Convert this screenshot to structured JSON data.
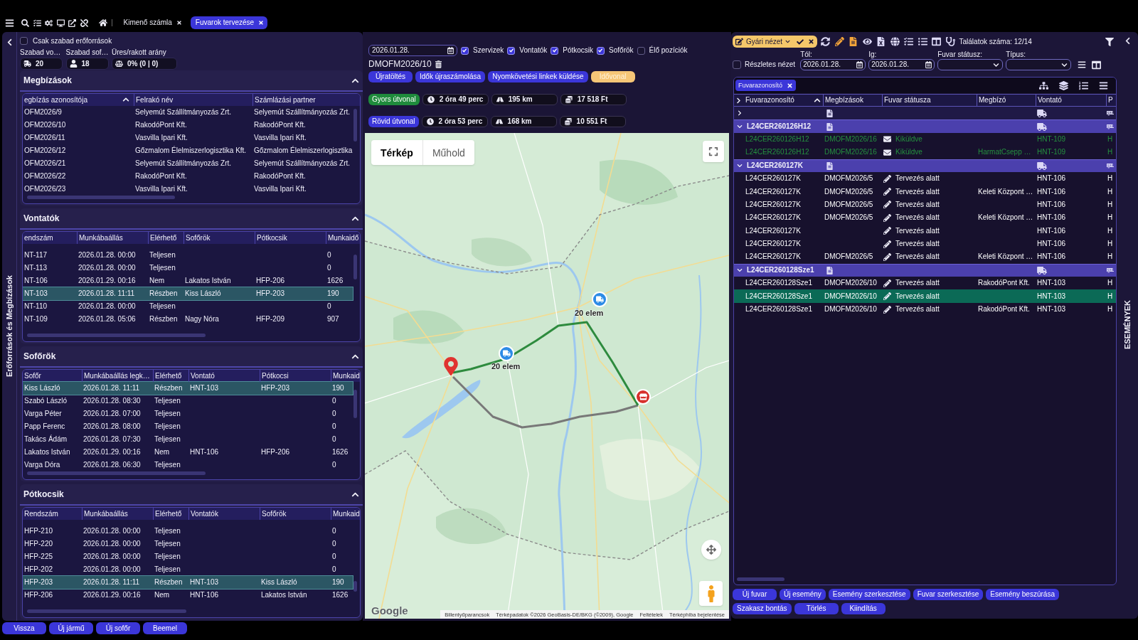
{
  "toolbar": {
    "tabs": [
      {
        "label": "Kimenő számla",
        "selected": false
      },
      {
        "label": "Fuvarok tervezése",
        "selected": true
      }
    ]
  },
  "resources_panel": {
    "rail_label": "Erőforrások és Megbízások",
    "free_only": {
      "label": "Csak szabad erőforrások",
      "checked": false
    },
    "stats": [
      {
        "kind": "vehicle",
        "label": "Szabad vo…",
        "value": "20"
      },
      {
        "kind": "driver",
        "label": "Szabad sof…",
        "value": "18"
      },
      {
        "kind": "ratio",
        "label": "Üres/rakott arány",
        "value": "0% (0 | 0)"
      }
    ],
    "sections": [
      {
        "title": "Megbízások",
        "expanded": true,
        "columns": [
          {
            "label": "egbízás azonosítója",
            "sorted": true
          },
          {
            "label": "Felrakó név",
            "sorted": false
          },
          {
            "label": "Számlázási partner",
            "sorted": false
          }
        ],
        "rows": [
          {
            "cells": [
              "OFM2026/9",
              "Selyemút Szállítmányozás Zrt.",
              "Selyemút Szállítmányozás Zrt."
            ],
            "selected": false
          },
          {
            "cells": [
              "OFM2026/10",
              "RakodóPont Kft.",
              "RakodóPont Kft."
            ],
            "selected": false
          },
          {
            "cells": [
              "OFM2026/11",
              "Vasvilla Ipari Kft.",
              "Vasvilla Ipari Kft."
            ],
            "selected": false
          },
          {
            "cells": [
              "OFM2026/12",
              "Gőzmalom Élelmiszerlogisztika Kft.",
              "Gőzmalom Élelmiszerlogisztika"
            ],
            "selected": false
          },
          {
            "cells": [
              "OFM2026/21",
              "Selyemút Szállítmányozás Zrt.",
              "Selyemút Szállítmányozás Zrt."
            ],
            "selected": false
          },
          {
            "cells": [
              "OFM2026/22",
              "RakodóPont Kft.",
              "RakodóPont Kft."
            ],
            "selected": false
          },
          {
            "cells": [
              "OFM2026/23",
              "Vasvilla Ipari Kft.",
              "Vasvilla Ipari Kft."
            ],
            "selected": false
          }
        ]
      },
      {
        "title": "Vontatók",
        "expanded": true,
        "columns": [
          {
            "label": "endszám",
            "sorted": false
          },
          {
            "label": "Munkábaállás",
            "sorted": false
          },
          {
            "label": "Elérhető",
            "sorted": false
          },
          {
            "label": "Sofőrök",
            "sorted": false
          },
          {
            "label": "Pótkocsik",
            "sorted": false
          },
          {
            "label": "Munkaidő",
            "sorted": false
          }
        ],
        "rows": [
          {
            "cells": [
              "NT-117",
              "2026.01.28. 00:00",
              "Teljesen",
              null,
              null,
              "0"
            ],
            "selected": false
          },
          {
            "cells": [
              "NT-113",
              "2026.01.28. 00:00",
              "Teljesen",
              null,
              null,
              "0"
            ],
            "selected": false
          },
          {
            "cells": [
              "NT-106",
              "2026.01.29. 00:16",
              "Nem",
              "Lakatos István",
              "HFP-206",
              "1626"
            ],
            "selected": false
          },
          {
            "cells": [
              "NT-103",
              "2026.01.28. 11:11",
              "Részben",
              "Kiss László",
              "HFP-203",
              "190"
            ],
            "selected": true
          },
          {
            "cells": [
              "NT-110",
              "2026.01.28. 00:00",
              "Teljesen",
              null,
              null,
              "0"
            ],
            "selected": false
          },
          {
            "cells": [
              "NT-109",
              "2026.01.28. 05:06",
              "Részben",
              "Nagy Nóra",
              "HFP-209",
              "907"
            ],
            "selected": false
          }
        ]
      },
      {
        "title": "Sofőrök",
        "expanded": true,
        "columns": [
          {
            "label": "Sofőr",
            "sorted": false
          },
          {
            "label": "Munkábaállás legk…",
            "sorted": false
          },
          {
            "label": "Elérhető",
            "sorted": false
          },
          {
            "label": "Vontató",
            "sorted": false
          },
          {
            "label": "Pótkocsi",
            "sorted": false
          },
          {
            "label": "Munkaid",
            "sorted": false
          }
        ],
        "rows": [
          {
            "cells": [
              "Kiss László",
              "2026.01.28. 11:11",
              "Részben",
              "HNT-103",
              "HFP-203",
              "190"
            ],
            "selected": true
          },
          {
            "cells": [
              "Szabó László",
              "2026.01.28. 08:30",
              "Teljesen",
              null,
              null,
              "0"
            ],
            "selected": false
          },
          {
            "cells": [
              "Varga Péter",
              "2026.01.28. 07:00",
              "Teljesen",
              null,
              null,
              "0"
            ],
            "selected": false
          },
          {
            "cells": [
              "Papp Ferenc",
              "2026.01.28. 08:00",
              "Teljesen",
              null,
              null,
              "0"
            ],
            "selected": false
          },
          {
            "cells": [
              "Takács Ádám",
              "2026.01.28. 07:30",
              "Teljesen",
              null,
              null,
              "0"
            ],
            "selected": false
          },
          {
            "cells": [
              "Lakatos István",
              "2026.01.29. 00:16",
              "Nem",
              "HNT-106",
              "HFP-206",
              "1626"
            ],
            "selected": false
          },
          {
            "cells": [
              "Varga Dóra",
              "2026.01.28. 06:30",
              "Teljesen",
              null,
              null,
              "0"
            ],
            "selected": false
          }
        ]
      },
      {
        "title": "Pótkocsik",
        "expanded": true,
        "columns": [
          {
            "label": "Rendszám",
            "sorted": false
          },
          {
            "label": "Munkábaállás",
            "sorted": false
          },
          {
            "label": "Elérhető",
            "sorted": false
          },
          {
            "label": "Vontatók",
            "sorted": false
          },
          {
            "label": "Sofőrök",
            "sorted": false
          },
          {
            "label": "Munkaid",
            "sorted": false
          }
        ],
        "rows": [
          {
            "cells": [
              "HFP-210",
              "2026.01.28. 00:00",
              "Teljesen",
              null,
              null,
              "0"
            ],
            "selected": false
          },
          {
            "cells": [
              "HFP-220",
              "2026.01.28. 00:00",
              "Teljesen",
              null,
              null,
              "0"
            ],
            "selected": false
          },
          {
            "cells": [
              "HFP-225",
              "2026.01.28. 00:00",
              "Teljesen",
              null,
              null,
              "0"
            ],
            "selected": false
          },
          {
            "cells": [
              "HFP-202",
              "2026.01.28. 00:00",
              "Teljesen",
              null,
              null,
              "0"
            ],
            "selected": false
          },
          {
            "cells": [
              "HFP-203",
              "2026.01.28. 11:11",
              "Részben",
              "HNT-103",
              "Kiss László",
              "190"
            ],
            "selected": true
          },
          {
            "cells": [
              "HFP-206",
              "2026.01.29. 00:16",
              "Nem",
              "HNT-106",
              "Lakatos István",
              "1626"
            ],
            "selected": false
          }
        ]
      }
    ]
  },
  "bottom_buttons": [
    "Vissza",
    "Új jármű",
    "Új sofőr",
    "Beemel"
  ],
  "planner": {
    "date": "2026.01.28.",
    "layers": [
      {
        "label": "Szervizek",
        "checked": true
      },
      {
        "label": "Vontatók",
        "checked": true
      },
      {
        "label": "Pótkocsik",
        "checked": true
      },
      {
        "label": "Sofőrök",
        "checked": true
      },
      {
        "label": "Élő pozíciók",
        "checked": false
      }
    ],
    "order_id": "DMOFM2026/10",
    "actions": [
      {
        "label": "Újratöltés",
        "kind": "primary"
      },
      {
        "label": "Idők újraszámolása",
        "kind": "primary"
      },
      {
        "label": "Nyomkövetési linkek küldése",
        "kind": "primary"
      },
      {
        "label": "Idővonal",
        "kind": "warning"
      }
    ],
    "routes": [
      {
        "label": "Gyors útvonal",
        "color": "#1f8b3c",
        "duration": "2 óra 49 perc",
        "distance": "195 km",
        "cost": "17 518 Ft"
      },
      {
        "label": "Rövid útvonal",
        "color": "#3b36d9",
        "duration": "2 óra 53 perc",
        "distance": "168 km",
        "cost": "10 551 Ft"
      }
    ],
    "map": {
      "types": [
        {
          "label": "Térkép",
          "selected": true
        },
        {
          "label": "Műhold",
          "selected": false
        }
      ],
      "markers": [
        {
          "kind": "vehicle",
          "label": "20 elem"
        },
        {
          "kind": "vehicle",
          "label": "20 elem"
        },
        {
          "kind": "pickup"
        },
        {
          "kind": "dropoff"
        }
      ],
      "logo": "Google",
      "attribution": [
        "Billentyűparancsok",
        "Térképadatok ©2026 GeoBasis-DE/BKG (©2009), Google",
        "Feltételek",
        "Térképhiba bejelentése"
      ]
    }
  },
  "events_panel": {
    "rail_label": "ESEMÉNYEK",
    "view": "Gyári nézet",
    "result_count": "Találatok száma: 12/14",
    "detailed_view": {
      "label": "Részletes nézet",
      "checked": false
    },
    "filters": [
      {
        "kind": "date",
        "label": "Tól:",
        "value": "2026.01.28."
      },
      {
        "kind": "date",
        "label": "Ig:",
        "value": "2026.01.28."
      },
      {
        "kind": "select",
        "label": "Fuvar státusz:"
      },
      {
        "kind": "select",
        "label": "Típus:"
      }
    ],
    "grid": {
      "group_chip": "Fuvarazonosító",
      "columns": [
        {
          "label": "Fuvarazonosító",
          "sorted": true
        },
        {
          "label": "Megbízások",
          "sorted": false
        },
        {
          "label": "Fuvar státusza",
          "sorted": false
        },
        {
          "label": "Megbízó",
          "sorted": false
        },
        {
          "label": "Vontató",
          "sorted": false
        },
        {
          "label": "P",
          "sorted": false
        }
      ],
      "groups": [
        {
          "kind": "blank",
          "expanded": false
        },
        {
          "kind": "group",
          "label": "L24CER260126H12",
          "expanded": true,
          "rows": [
            {
              "kind": "sent",
              "cells": [
                "L24CER260126H12",
                "DMOFM2026/16",
                "Kiküldve",
                null,
                "HNT-109",
                "H"
              ],
              "selected": false
            },
            {
              "kind": "sent",
              "cells": [
                "L24CER260126H12",
                "DMOFM2026/16",
                "Kiküldve",
                "HarmatCsepp …",
                "HNT-109",
                "H"
              ],
              "selected": false
            }
          ]
        },
        {
          "kind": "group",
          "label": "L24CER260127K",
          "expanded": true,
          "rows": [
            {
              "kind": "planning",
              "cells": [
                "L24CER260127K",
                "DMOFM2026/5",
                "Tervezés alatt",
                null,
                "HNT-106",
                "H"
              ],
              "selected": false
            },
            {
              "kind": "planning",
              "cells": [
                "L24CER260127K",
                "DMOFM2026/5",
                "Tervezés alatt",
                "Keleti Központ …",
                "HNT-106",
                "H"
              ],
              "selected": false
            },
            {
              "kind": "planning",
              "cells": [
                "L24CER260127K",
                "DMOFM2026/5",
                "Tervezés alatt",
                null,
                "HNT-106",
                "H"
              ],
              "selected": false
            },
            {
              "kind": "planning",
              "cells": [
                "L24CER260127K",
                "DMOFM2026/5",
                "Tervezés alatt",
                "Keleti Központ …",
                "HNT-106",
                "H"
              ],
              "selected": false
            },
            {
              "kind": "planning",
              "cells": [
                "L24CER260127K",
                null,
                "Tervezés alatt",
                null,
                "HNT-106",
                "H"
              ],
              "selected": false
            },
            {
              "kind": "planning",
              "cells": [
                "L24CER260127K",
                null,
                "Tervezés alatt",
                null,
                "HNT-106",
                "H"
              ],
              "selected": false
            },
            {
              "kind": "planning",
              "cells": [
                "L24CER260127K",
                "DMOFM2026/5",
                "Tervezés alatt",
                "Keleti Központ …",
                "HNT-106",
                "H"
              ],
              "selected": false
            }
          ]
        },
        {
          "kind": "group",
          "label": "L24CER260128Sze1",
          "expanded": true,
          "rows": [
            {
              "kind": "planning",
              "cells": [
                "L24CER260128Sze1",
                "DMOFM2026/10",
                "Tervezés alatt",
                "RakodóPont Kft.",
                "HNT-103",
                "H"
              ],
              "selected": false
            },
            {
              "kind": "planning",
              "cells": [
                "L24CER260128Sze1",
                "DMOFM2026/10",
                "Tervezés alatt",
                null,
                "HNT-103",
                "H"
              ],
              "selected": true
            },
            {
              "kind": "planning",
              "cells": [
                "L24CER260128Sze1",
                "DMOFM2026/10",
                "Tervezés alatt",
                "RakodóPont Kft.",
                "HNT-103",
                "H"
              ],
              "selected": false
            }
          ]
        }
      ]
    },
    "buttons": [
      "Új fuvar",
      "Új esemény",
      "Esemény szerkesztése",
      "Fuvar szerkesztése",
      "Esemény beszúrása",
      "Szakasz bontás",
      "Törlés",
      "Kiindítás"
    ]
  }
}
